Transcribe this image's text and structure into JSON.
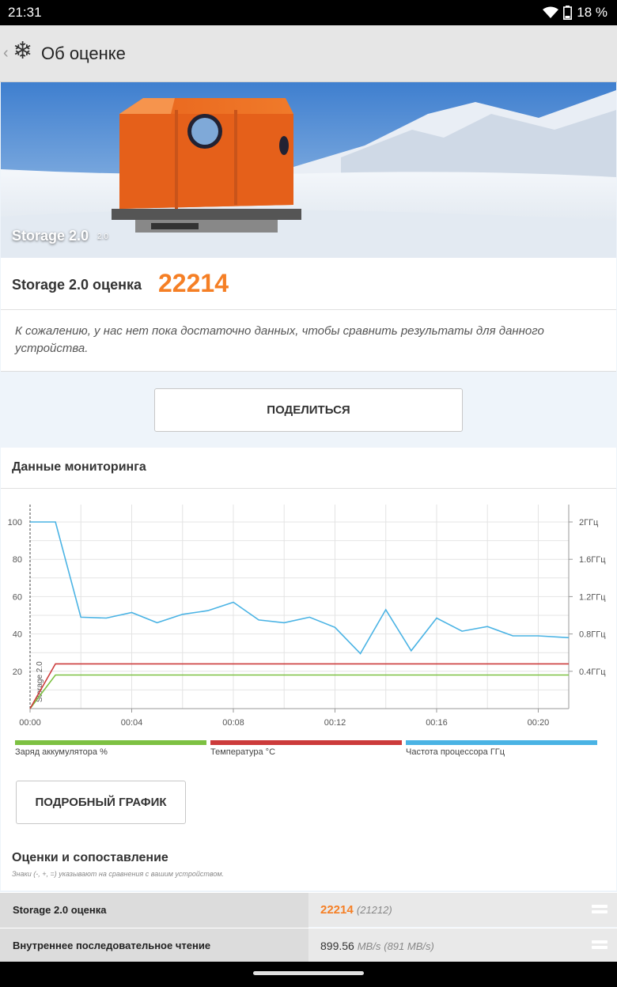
{
  "status": {
    "time": "21:31",
    "battery": "18 %"
  },
  "header": {
    "title": "Об оценке",
    "back_icon": "chevron-left-icon",
    "app_icon": "snowflake-icon"
  },
  "hero": {
    "title": "Storage 2.0",
    "version": "2.0"
  },
  "score": {
    "label": "Storage 2.0 оценка",
    "value": "22214",
    "message": "К сожалению, у нас нет пока достаточно данных, чтобы сравнить результаты для данного устройства."
  },
  "share_button": "ПОДЕЛИТЬСЯ",
  "monitoring": {
    "title": "Данные мониторинга",
    "detail_button": "ПОДРОБНЫЙ ГРАФИК"
  },
  "chart_data": {
    "type": "line",
    "x_ticks": [
      "00:00",
      "00:04",
      "00:08",
      "00:12",
      "00:16",
      "00:20"
    ],
    "x_tick_minutes": [
      0,
      4,
      8,
      12,
      16,
      20
    ],
    "xlim_minutes": [
      0,
      21.2
    ],
    "y_left_ticks": [
      20,
      40,
      60,
      80,
      100
    ],
    "y_left_lim": [
      0,
      100
    ],
    "y_right_ticks": [
      "0.4ГГц",
      "0.8ГГц",
      "1.2ГГц",
      "1.6ГГц",
      "2ГГц"
    ],
    "y_right_ticks_ghz": [
      0.4,
      0.8,
      1.2,
      1.6,
      2
    ],
    "y_right_lim_ghz": [
      0,
      2
    ],
    "marker_label": "Storage 2.0",
    "grid": true,
    "series": [
      {
        "name": "Заряд аккумулятора %",
        "color": "#7dc142",
        "axis": "left",
        "points": [
          [
            0,
            0
          ],
          [
            1,
            18
          ],
          [
            21.2,
            18
          ]
        ]
      },
      {
        "name": "Температура °C",
        "color": "#cc3b3b",
        "axis": "left",
        "points": [
          [
            0,
            0
          ],
          [
            1,
            24
          ],
          [
            21.2,
            24
          ]
        ]
      },
      {
        "name": "Частота процессора ГГц",
        "color": "#4ab3e4",
        "axis": "right",
        "points": [
          [
            0,
            2.0
          ],
          [
            1,
            2.0
          ],
          [
            2,
            0.98
          ],
          [
            3,
            0.97
          ],
          [
            4,
            1.03
          ],
          [
            5,
            0.92
          ],
          [
            6,
            1.01
          ],
          [
            7,
            1.05
          ],
          [
            8,
            1.14
          ],
          [
            9,
            0.95
          ],
          [
            10,
            0.92
          ],
          [
            11,
            0.98
          ],
          [
            12,
            0.87
          ],
          [
            13,
            0.59
          ],
          [
            14,
            1.06
          ],
          [
            15,
            0.62
          ],
          [
            16,
            0.97
          ],
          [
            17,
            0.83
          ],
          [
            18,
            0.88
          ],
          [
            19,
            0.78
          ],
          [
            20,
            0.78
          ],
          [
            21.2,
            0.76
          ]
        ]
      }
    ]
  },
  "compare": {
    "title": "Оценки и сопоставление",
    "note": "Знаки (-, +, =) указывают на сравнения с вашим устройством.",
    "rows": [
      {
        "label": "Storage 2.0 оценка",
        "value": "22214",
        "unit": "",
        "ref": "(21212)"
      },
      {
        "label": "Внутреннее последовательное чтение",
        "value": "899.56",
        "unit": "MB/s",
        "ref": "(891 MB/s)"
      }
    ]
  }
}
